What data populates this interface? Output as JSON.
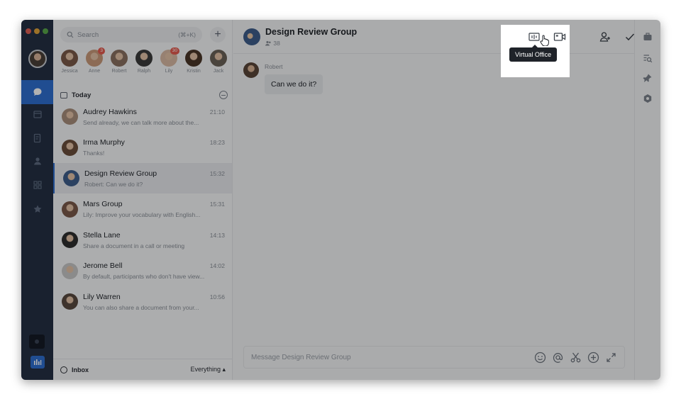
{
  "search": {
    "placeholder": "Search",
    "shortcut": "(⌘+K)"
  },
  "contacts": [
    {
      "name": "Jessica",
      "badge": "",
      "color": "#7a5a48"
    },
    {
      "name": "Anne",
      "badge": "3",
      "color": "#c99a7a"
    },
    {
      "name": "Robert",
      "badge": "",
      "color": "#8a7060"
    },
    {
      "name": "Ralph",
      "badge": "",
      "color": "#3b3b3b"
    },
    {
      "name": "Lily",
      "badge": "30",
      "color": "#d9b9a4"
    },
    {
      "name": "Kristin",
      "badge": "",
      "color": "#4a3528"
    },
    {
      "name": "Jack",
      "badge": "",
      "color": "#6b6258"
    }
  ],
  "list": {
    "section_title": "Today",
    "conversations": [
      {
        "name": "Audrey Hawkins",
        "time": "21:10",
        "preview": "Send already, we can talk more about the...",
        "color": "#a88e7c"
      },
      {
        "name": "Irma Murphy",
        "time": "18:23",
        "preview": "Thanks!",
        "color": "#6a4e3c"
      },
      {
        "name": "Design Review Group",
        "time": "15:32",
        "preview": "Robert: Can we do it?",
        "color": "#3e5d8c"
      },
      {
        "name": "Mars Group",
        "time": "15:31",
        "preview": "Lily: Improve your vocabulary with English...",
        "color": "#7a5a4a"
      },
      {
        "name": "Stella Lane",
        "time": "14:13",
        "preview": "Share a document in a call or meeting",
        "color": "#2e2e2e"
      },
      {
        "name": "Jerome Bell",
        "time": "14:02",
        "preview": "By default, participants who don't have view...",
        "color": "#c8c8c8"
      },
      {
        "name": "Lily Warren",
        "time": "10:56",
        "preview": "You can also share a document from your...",
        "color": "#5a4a40"
      }
    ],
    "footer_label": "Inbox",
    "footer_filter": "Everything ▴"
  },
  "chat": {
    "title": "Design Review Group",
    "member_count": "38",
    "message_author": "Robert",
    "message_text": "Can we do it?",
    "composer_placeholder": "Message Design Review Group"
  },
  "tooltip": {
    "text": "Virtual Office"
  },
  "colors": {
    "accent": "#2f6fd0",
    "rail": "#243044",
    "badge": "#e45b4f"
  }
}
